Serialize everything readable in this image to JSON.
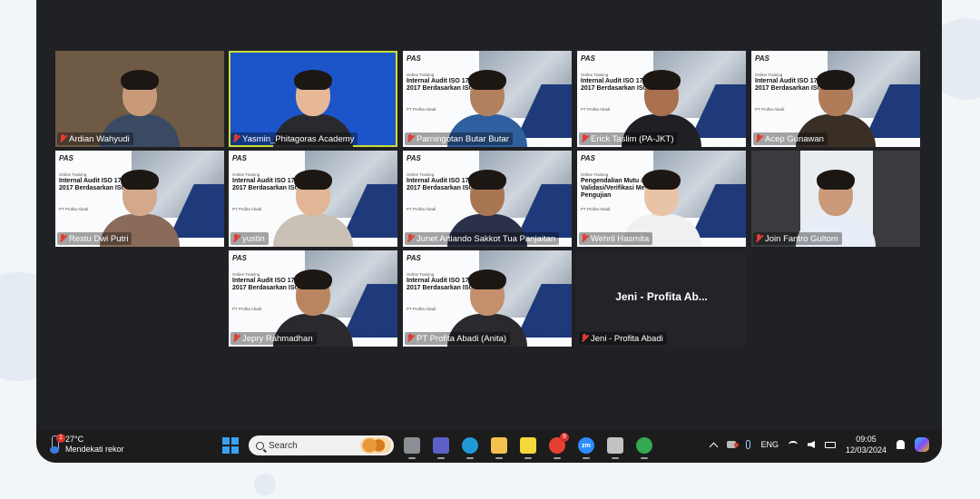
{
  "participants": [
    {
      "name": "Ardian Wahyudi",
      "kind": "camera",
      "bg": "#6e5a45"
    },
    {
      "name": "Yasmin_Phitagoras Academy",
      "kind": "camera",
      "bg": "#1c55c9",
      "active": true
    },
    {
      "name": "Parningotan Butar Butar",
      "kind": "slide"
    },
    {
      "name": "Erick Taslim (PA-JKT)",
      "kind": "slide"
    },
    {
      "name": "Acep Gunawan",
      "kind": "slide"
    },
    {
      "name": "Restu Dwi Putri",
      "kind": "slide"
    },
    {
      "name": "yustin",
      "kind": "slide"
    },
    {
      "name": "Junet Artiando Sakkot Tua Panjaitan",
      "kind": "slide"
    },
    {
      "name": "Wehril Hasmita",
      "kind": "slide2"
    },
    {
      "name": "Join Fantro Gultom",
      "kind": "camera-dark"
    },
    {
      "name": "Jepry Rahmadhan",
      "kind": "slide"
    },
    {
      "name": "PT Profita Abadi (Anita)",
      "kind": "slide"
    },
    {
      "name": "Jeni - Profita Abadi",
      "kind": "no-video",
      "display": "Jeni - Profita Ab..."
    }
  ],
  "slide": {
    "logo": "PAS",
    "small": "Online Training",
    "title": "Internal Audit ISO 17025 : 2017 Berdasarkan ISO 19011",
    "org": "PT Profita Abadi",
    "site": "www.phitagoras.co.id"
  },
  "slide2": {
    "title": "Pengendalian Mutu & Validasi/Verifikasi Metode Pengujian"
  },
  "taskbar": {
    "weather_temp": "27°C",
    "weather_desc": "Mendekati rekor",
    "weather_badge": "1",
    "search_placeholder": "Search",
    "apps": [
      {
        "icon": "task-view-icon",
        "color": "#8a8f96"
      },
      {
        "icon": "teams-icon",
        "color": "#5b5fc7"
      },
      {
        "icon": "edge-icon",
        "color": "#1f9ad6"
      },
      {
        "icon": "file-explorer-icon",
        "color": "#f3c24d"
      },
      {
        "icon": "sticky-notes-icon",
        "color": "#f7d83a"
      },
      {
        "icon": "chrome-icon",
        "color": "#e44133",
        "badge": "9"
      },
      {
        "icon": "zoom-icon",
        "color": "#2d8cff",
        "label": "zm"
      },
      {
        "icon": "media-player-icon",
        "color": "#c2c2c2"
      },
      {
        "icon": "chrome-profile-icon",
        "color": "#34a853"
      }
    ],
    "language": "ENG",
    "time": "09:05",
    "date": "12/03/2024"
  }
}
